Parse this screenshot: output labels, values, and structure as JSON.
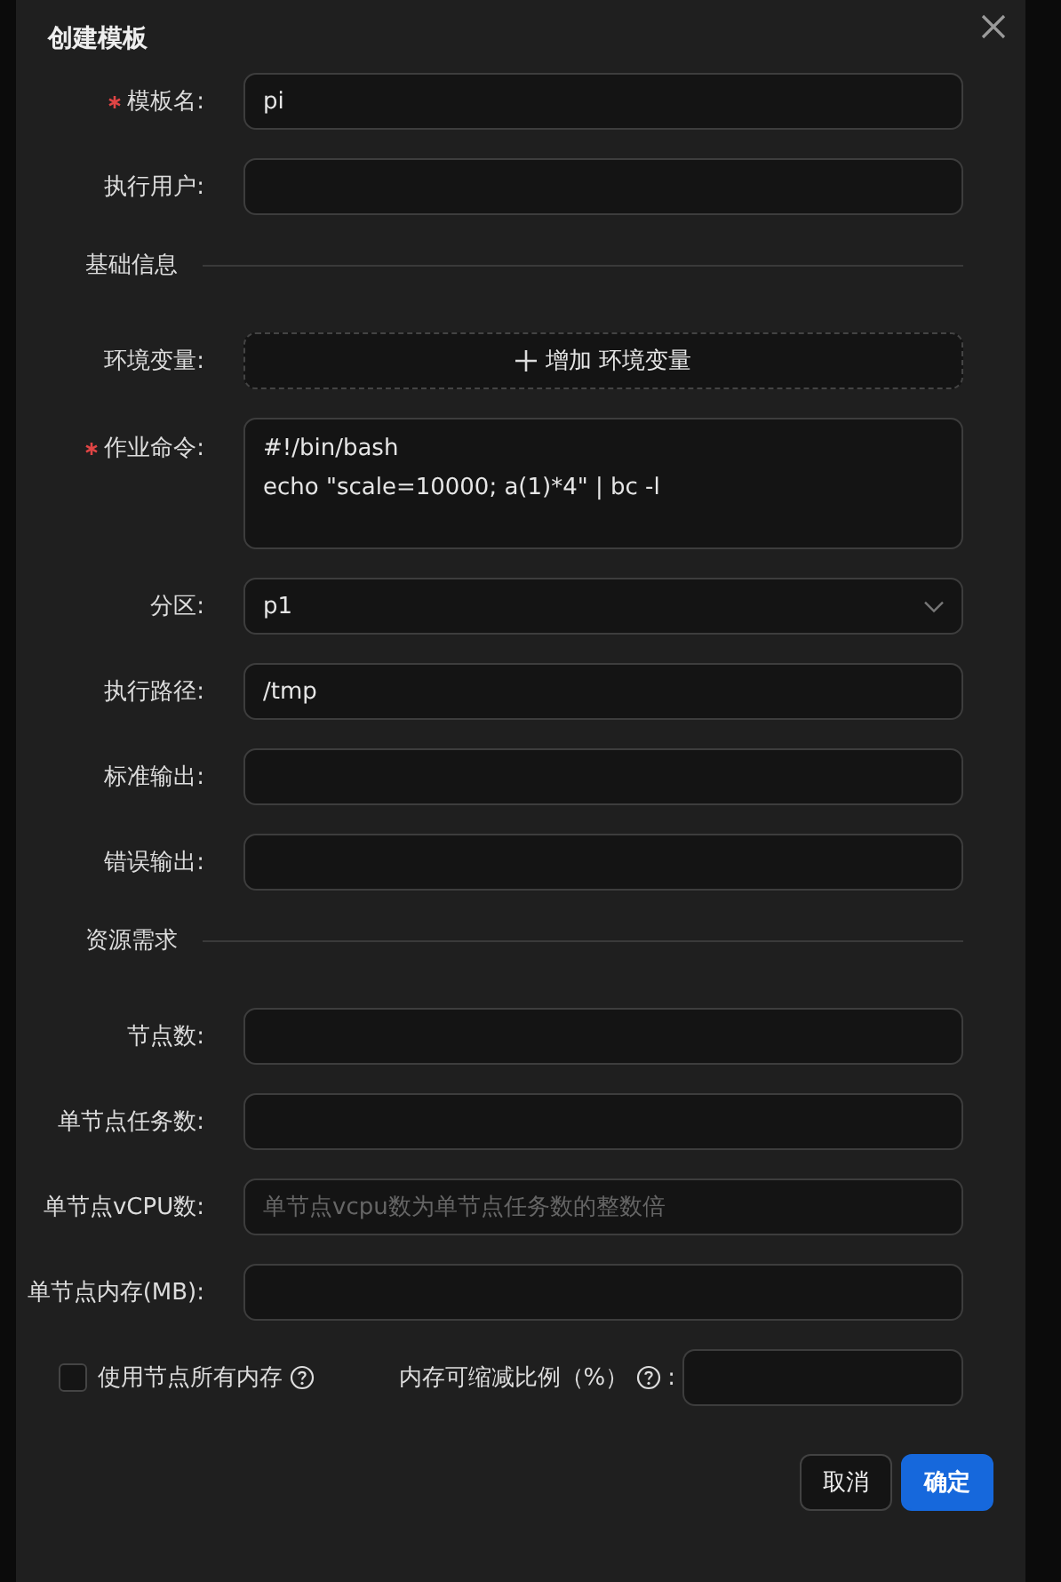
{
  "dialog": {
    "title": "创建模板"
  },
  "form": [
    {
      "kind": "field",
      "label": "模板名:",
      "required": true,
      "value": "pi"
    },
    {
      "kind": "field",
      "label": "执行用户:",
      "required": false
    },
    {
      "kind": "section",
      "title": "基础信息"
    },
    {
      "kind": "add",
      "label": "环境变量:",
      "required": false,
      "button": "增加 环境变量"
    },
    {
      "kind": "textarea",
      "label": "作业命令:",
      "required": true,
      "lines": [
        "#!/bin/bash",
        "echo \"scale=10000; a(1)*4\" | bc -l"
      ]
    },
    {
      "kind": "select",
      "label": "分区:",
      "required": false,
      "value": "p1"
    },
    {
      "kind": "field",
      "label": "执行路径:",
      "required": false,
      "value": "/tmp"
    },
    {
      "kind": "field",
      "label": "标准输出:",
      "required": false
    },
    {
      "kind": "field",
      "label": "错误输出:",
      "required": false
    },
    {
      "kind": "section",
      "title": "资源需求"
    },
    {
      "kind": "field",
      "label": "节点数:",
      "required": false
    },
    {
      "kind": "field",
      "label": "单节点任务数:",
      "required": false
    },
    {
      "kind": "field",
      "label": "单节点vCPU数:",
      "required": false,
      "placeholder": "单节点vcpu数为单节点任务数的整数倍"
    },
    {
      "kind": "field",
      "label": "单节点内存(MB):",
      "required": false
    }
  ],
  "memory_option": {
    "label": "使用节点所有内存",
    "checked": false,
    "ratio_label": "内存可缩减比例（%）",
    "colon": ":"
  },
  "buttons": [
    {
      "label": "取消",
      "primary": false
    },
    {
      "label": "确定",
      "primary": true
    }
  ]
}
